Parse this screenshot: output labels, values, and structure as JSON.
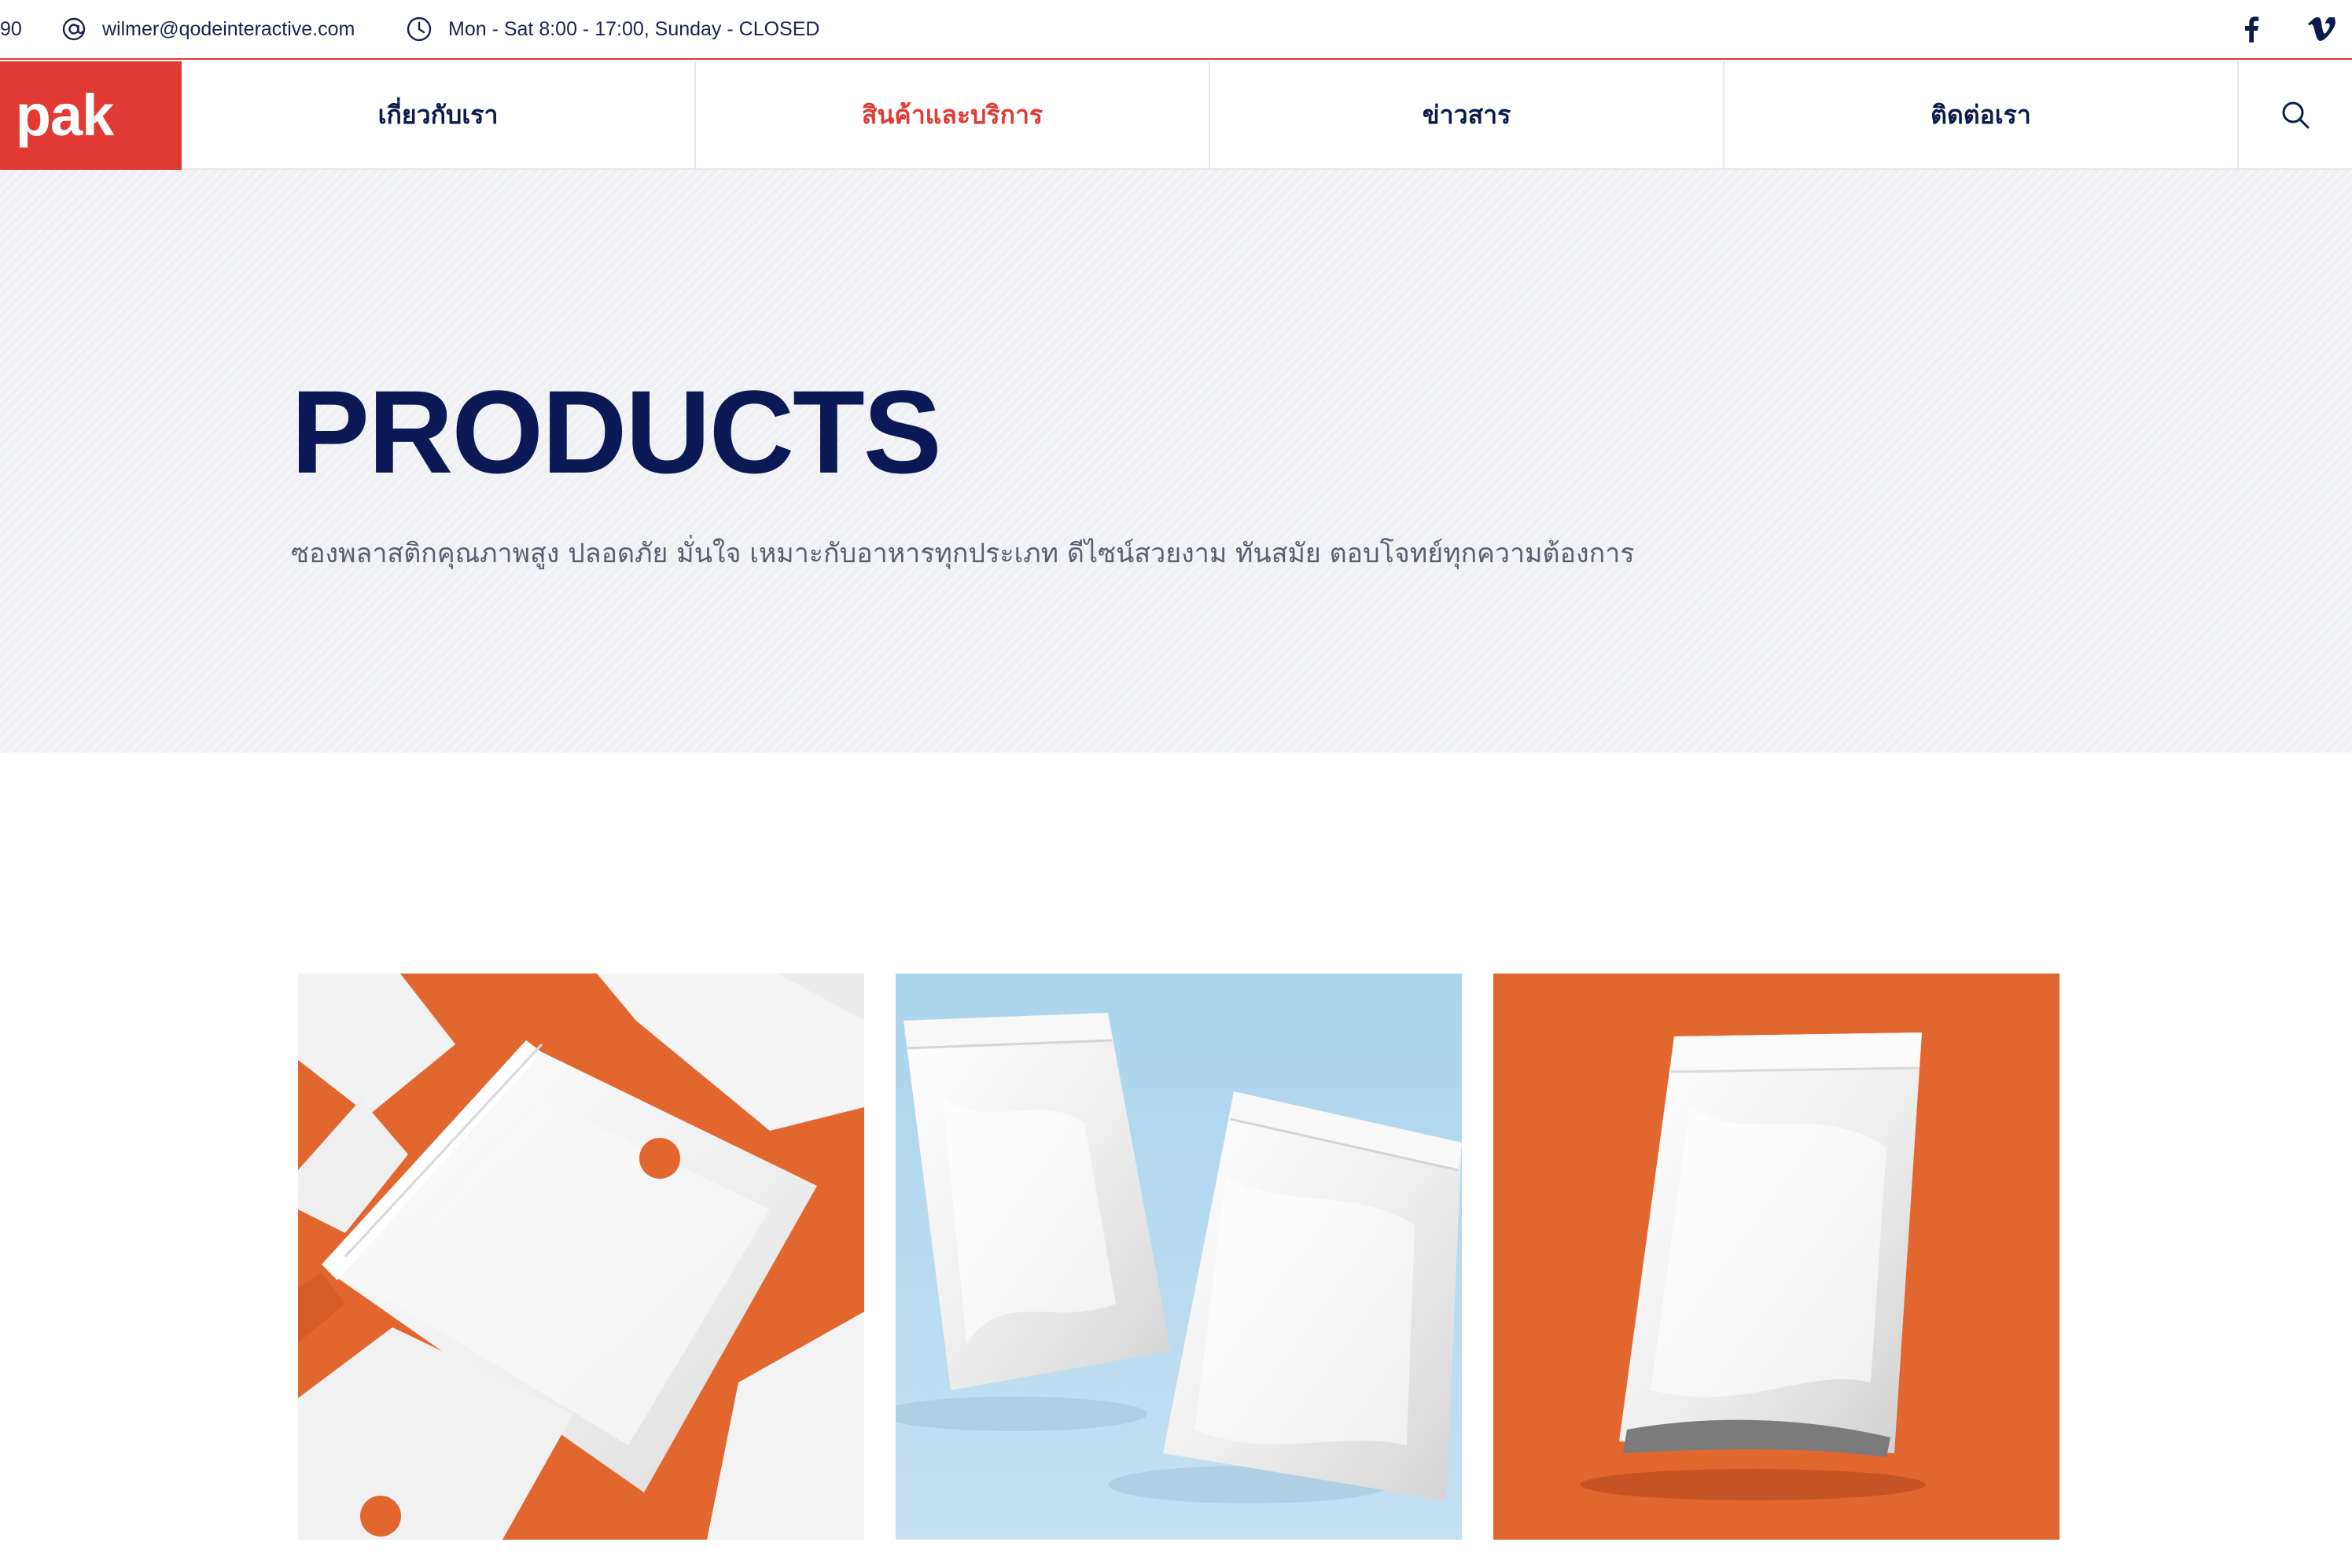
{
  "topbar": {
    "phone_fragment": "90",
    "email": "wilmer@qodeinteractive.com",
    "hours": "Mon - Sat 8:00 - 17:00, Sunday - CLOSED",
    "icons": [
      "at-icon",
      "clock-icon",
      "facebook-icon",
      "vimeo-icon"
    ]
  },
  "header": {
    "logo_text": "c pak",
    "menu": [
      {
        "label": "เกี่ยวกับเรา",
        "active": false
      },
      {
        "label": "สินค้าและบริการ",
        "active": true
      },
      {
        "label": "ข่าวสาร",
        "active": false
      },
      {
        "label": "ติดต่อเรา",
        "active": false
      }
    ],
    "search_icon": "search-icon"
  },
  "hero": {
    "title": "PRODUCTS",
    "subtitle": "ซองพลาสติกคุณภาพสูง ปลอดภัย มั่นใจ เหมาะกับอาหารทุกประเภท ดีไซน์สวยงาม ทันสมัย ตอบโจทย์ทุกความต้องการ"
  },
  "products": [
    {
      "image": "white zip pouches on orange background"
    },
    {
      "image": "two white stand-up pouches on light blue background"
    },
    {
      "image": "white stand-up pouch on orange background"
    }
  ],
  "colors": {
    "accent": "#e03a32",
    "navy": "#0b1a57",
    "hero_bg": "#eff0f3",
    "product_orange": "#e2672f",
    "product_blue": "#b3d8ef"
  }
}
